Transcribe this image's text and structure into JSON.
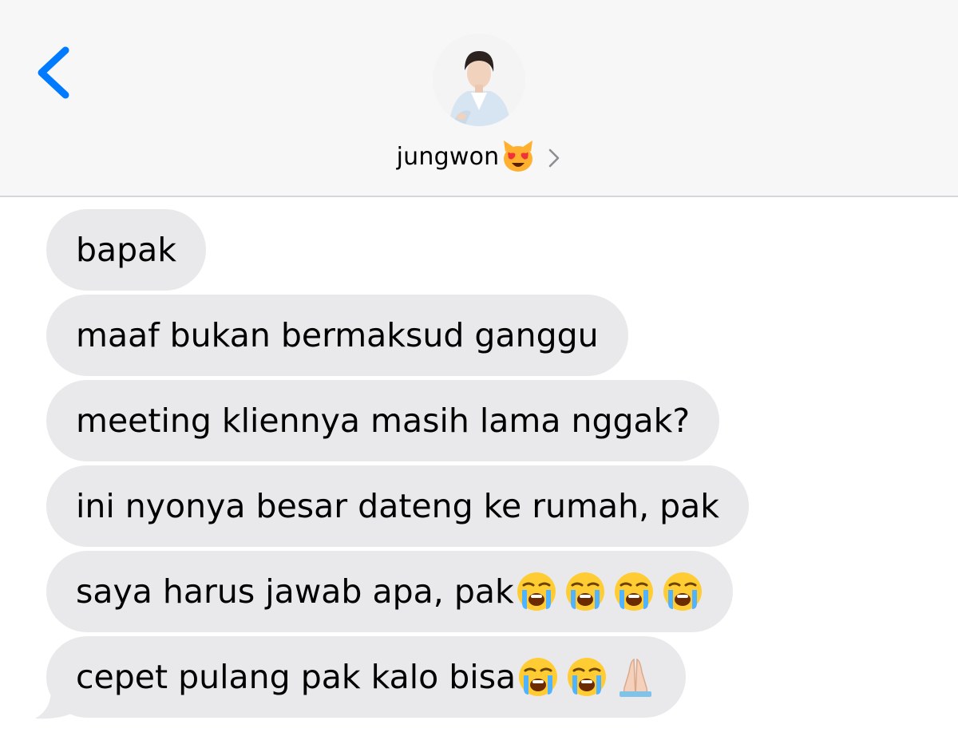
{
  "header": {
    "back_icon": "chevron-left-icon",
    "contact_name": "jungwon",
    "contact_emoji": "smiling-cat-heart-eyes-emoji",
    "details_icon": "chevron-right-icon",
    "accent_color": "#007aff"
  },
  "messages": [
    {
      "text": "bapak",
      "emojis": []
    },
    {
      "text": "maaf bukan bermaksud ganggu",
      "emojis": []
    },
    {
      "text": "meeting kliennya masih lama nggak?",
      "emojis": []
    },
    {
      "text": "ini nyonya besar dateng ke rumah, pak",
      "emojis": []
    },
    {
      "text": "saya harus jawab apa, pak",
      "emojis": [
        "loudly-crying-face",
        "loudly-crying-face",
        "loudly-crying-face",
        "loudly-crying-face"
      ]
    },
    {
      "text": "cepet pulang pak kalo bisa",
      "emojis": [
        "loudly-crying-face",
        "loudly-crying-face",
        "folded-hands"
      ]
    }
  ],
  "colors": {
    "bubble_bg": "#e9e9eb",
    "header_bg": "#f7f7f7"
  }
}
